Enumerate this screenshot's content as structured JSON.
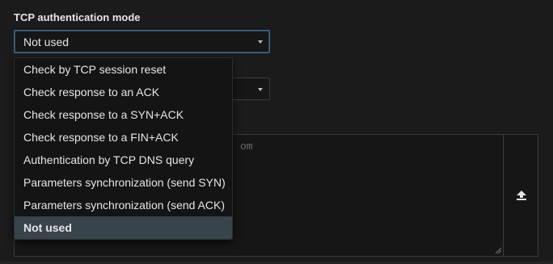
{
  "tcp_auth": {
    "label": "TCP authentication mode",
    "selected_value": "Not used",
    "options": [
      "Check by TCP session reset",
      "Check response to an ACK",
      "Check response to a SYN+ACK",
      "Check response to a FIN+ACK",
      "Authentication by TCP DNS query",
      "Parameters synchronization (send SYN)",
      "Parameters synchronization (send ACK)",
      "Not used"
    ],
    "selected_index": 7
  },
  "second_select": {
    "value": ""
  },
  "textarea": {
    "placeholder_fragment": "om"
  },
  "icons": {
    "caret": "chevron-down-icon",
    "upload": "upload-icon",
    "grip": "resize-grip-icon"
  },
  "colors": {
    "background": "#1b1b1b",
    "selected_option": "#37444b",
    "focus_border": "#3e6e8c"
  }
}
